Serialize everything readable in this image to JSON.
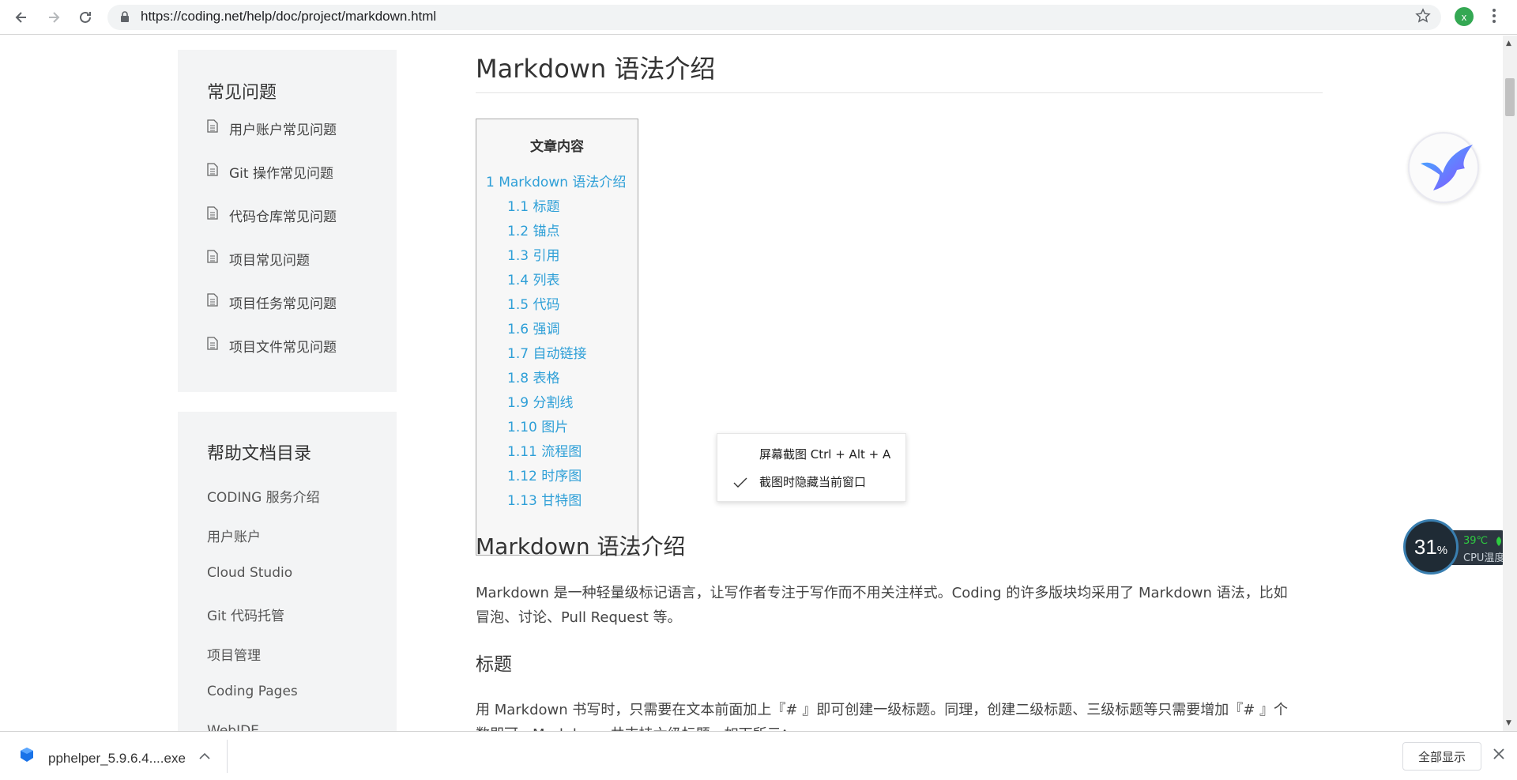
{
  "browser": {
    "url": "https://coding.net/help/doc/project/markdown.html",
    "profile_initial": "x",
    "icons": {
      "back": "back-arrow-icon",
      "forward": "forward-arrow-icon",
      "reload": "reload-icon",
      "lock": "lock-icon",
      "bookmark": "star-icon",
      "menu": "more-vert-icon"
    }
  },
  "sidebar": {
    "faq_title": "常见问题",
    "faq_items": [
      {
        "label": "用户账户常见问题"
      },
      {
        "label": "Git 操作常见问题"
      },
      {
        "label": "代码仓库常见问题"
      },
      {
        "label": "项目常见问题"
      },
      {
        "label": "项目任务常见问题"
      },
      {
        "label": "项目文件常见问题"
      }
    ],
    "toc_title": "帮助文档目录",
    "toc_items": [
      {
        "label": "CODING 服务介绍"
      },
      {
        "label": "用户账户"
      },
      {
        "label": "Cloud Studio"
      },
      {
        "label": "Git 代码托管"
      },
      {
        "label": "项目管理"
      },
      {
        "label": "Coding Pages"
      },
      {
        "label": "WebIDE"
      }
    ]
  },
  "main": {
    "title": "Markdown 语法介绍",
    "toc": {
      "heading": "文章内容",
      "items": [
        {
          "label": "1 Markdown 语法介绍",
          "level": 1
        },
        {
          "label": "1.1 标题",
          "level": 2
        },
        {
          "label": "1.2 锚点",
          "level": 2
        },
        {
          "label": "1.3 引用",
          "level": 2
        },
        {
          "label": "1.4 列表",
          "level": 2
        },
        {
          "label": "1.5 代码",
          "level": 2
        },
        {
          "label": "1.6 强调",
          "level": 2
        },
        {
          "label": "1.7 自动链接",
          "level": 2
        },
        {
          "label": "1.8 表格",
          "level": 2
        },
        {
          "label": "1.9 分割线",
          "level": 2
        },
        {
          "label": "1.10 图片",
          "level": 2
        },
        {
          "label": "1.11 流程图",
          "level": 2
        },
        {
          "label": "1.12 时序图",
          "level": 2
        },
        {
          "label": "1.13 甘特图",
          "level": 2
        }
      ]
    },
    "section_title": "Markdown 语法介绍",
    "intro_line1": "Markdown 是一种轻量级标记语言，让写作者专注于写作而不用关注样式。Coding 的许多版块均采用了 Markdown 语法，比如",
    "intro_line2": "冒泡、讨论、Pull Request 等。",
    "heading_title": "标题",
    "heading_text_line1": "用 Markdown 书写时，只需要在文本前面加上『# 』即可创建一级标题。同理，创建二级标题、三级标题等只需要增加『# 』个",
    "heading_text_line2": "数即可，Markdown 共支持六级标题，如下所示："
  },
  "context_menu": {
    "item1": "屏幕截图 Ctrl + Alt + A",
    "item2": "截图时隐藏当前窗口",
    "item2_checked": true
  },
  "cpu_widget": {
    "percent": "31",
    "percent_sign": "%",
    "temperature": "39℃",
    "label": "CPU温度"
  },
  "download_bar": {
    "file_name": "pphelper_5.9.6.4....exe",
    "show_all": "全部显示"
  },
  "colors": {
    "link": "#2e9fd7",
    "sidebar_bg": "#f3f4f5",
    "cpu_green": "#2ecc40"
  }
}
